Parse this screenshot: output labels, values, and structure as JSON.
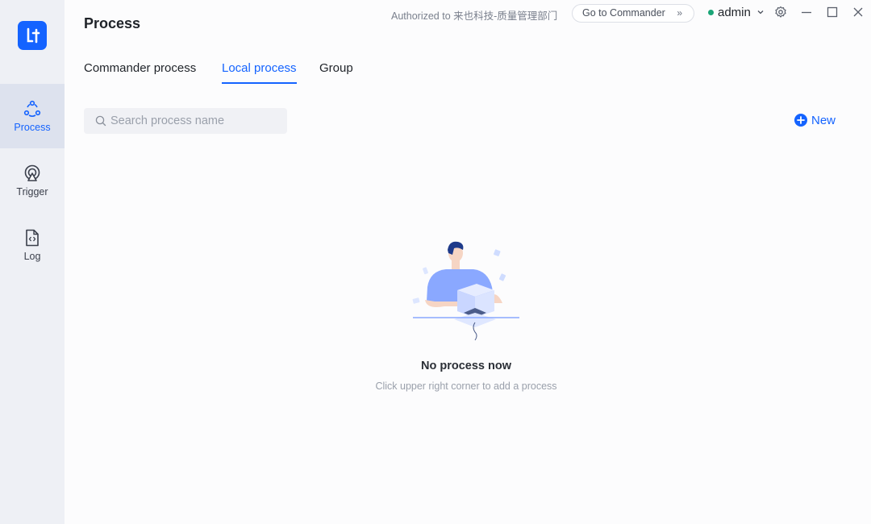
{
  "app": {
    "page_title": "Process",
    "authorized_text": "Authorized to 来也科技-质量管理部门",
    "goto_label": "Go to Commander",
    "user_name": "admin",
    "colors": {
      "accent": "#1463ff",
      "status_online": "#1aa577",
      "sidebar_bg": "#eef0f5"
    }
  },
  "sidebar": {
    "items": [
      {
        "label": "Process",
        "icon": "process-icon",
        "active": true
      },
      {
        "label": "Trigger",
        "icon": "trigger-icon",
        "active": false
      },
      {
        "label": "Log",
        "icon": "log-file-icon",
        "active": false
      }
    ]
  },
  "tabs": [
    {
      "label": "Commander process",
      "active": false
    },
    {
      "label": "Local process",
      "active": true
    },
    {
      "label": "Group",
      "active": false
    }
  ],
  "search": {
    "placeholder": "Search process name",
    "value": ""
  },
  "toolbar": {
    "new_label": "New"
  },
  "empty_state": {
    "title": "No process now",
    "subtitle": "Click upper right corner to add a process"
  }
}
